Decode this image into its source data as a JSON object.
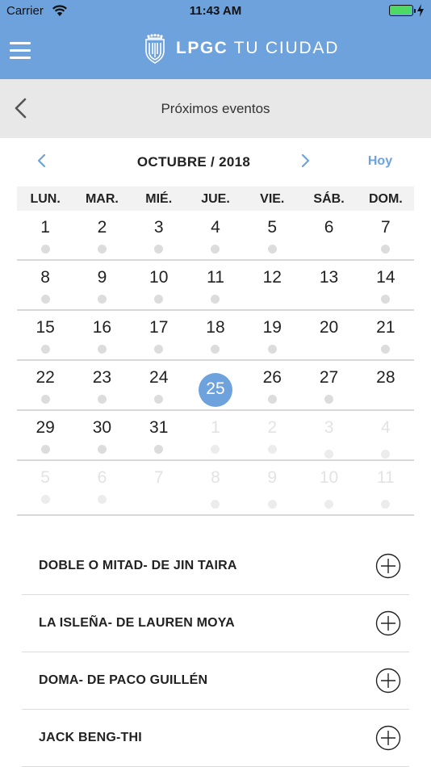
{
  "status": {
    "carrier": "Carrier",
    "time": "11:43 AM"
  },
  "header": {
    "brand_bold": "LPGC",
    "brand_light": "TU CIUDAD"
  },
  "subheader": {
    "title": "Próximos eventos"
  },
  "calendar": {
    "month_label": "OCTUBRE / 2018",
    "today_label": "Hoy",
    "weekdays": [
      "LUN.",
      "MAR.",
      "MIÉ.",
      "JUE.",
      "VIE.",
      "SÁB.",
      "DOM."
    ],
    "weeks": [
      [
        {
          "d": "1",
          "dot": "up"
        },
        {
          "d": "2",
          "dot": "up"
        },
        {
          "d": "3",
          "dot": "up"
        },
        {
          "d": "4",
          "dot": "up"
        },
        {
          "d": "5",
          "dot": "up"
        },
        {
          "d": "6",
          "dot": ""
        },
        {
          "d": "7",
          "dot": "up"
        }
      ],
      [
        {
          "d": "8",
          "dot": "up"
        },
        {
          "d": "9",
          "dot": "up"
        },
        {
          "d": "10",
          "dot": "up"
        },
        {
          "d": "11",
          "dot": "up"
        },
        {
          "d": "12",
          "dot": ""
        },
        {
          "d": "13",
          "dot": ""
        },
        {
          "d": "14",
          "dot": "up"
        }
      ],
      [
        {
          "d": "15",
          "dot": "up"
        },
        {
          "d": "16",
          "dot": "up"
        },
        {
          "d": "17",
          "dot": "up"
        },
        {
          "d": "18",
          "dot": "up"
        },
        {
          "d": "19",
          "dot": "up"
        },
        {
          "d": "20",
          "dot": ""
        },
        {
          "d": "21",
          "dot": "up"
        }
      ],
      [
        {
          "d": "22",
          "dot": "up"
        },
        {
          "d": "23",
          "dot": "up"
        },
        {
          "d": "24",
          "dot": "up"
        },
        {
          "d": "25",
          "dot": "up",
          "selected": true
        },
        {
          "d": "26",
          "dot": "up"
        },
        {
          "d": "27",
          "dot": "up"
        },
        {
          "d": "28",
          "dot": ""
        }
      ],
      [
        {
          "d": "29",
          "dot": "up"
        },
        {
          "d": "30",
          "dot": "up"
        },
        {
          "d": "31",
          "dot": "up"
        },
        {
          "d": "1",
          "dot": "up",
          "other": true
        },
        {
          "d": "2",
          "dot": "up",
          "other": true
        },
        {
          "d": "3",
          "dot": "down",
          "other": true
        },
        {
          "d": "4",
          "dot": "down",
          "other": true
        }
      ],
      [
        {
          "d": "5",
          "dot": "up",
          "other": true
        },
        {
          "d": "6",
          "dot": "up",
          "other": true
        },
        {
          "d": "7",
          "dot": "",
          "other": true
        },
        {
          "d": "8",
          "dot": "down",
          "other": true
        },
        {
          "d": "9",
          "dot": "down",
          "other": true
        },
        {
          "d": "10",
          "dot": "down",
          "other": true
        },
        {
          "d": "11",
          "dot": "down",
          "other": true
        }
      ]
    ]
  },
  "events": [
    {
      "title": "DOBLE O MITAD- DE JIN TAIRA"
    },
    {
      "title": "LA ISLEÑA- DE LAUREN MOYA"
    },
    {
      "title": "DOMA- DE PACO GUILLÉN"
    },
    {
      "title": "JACK BENG-THI"
    }
  ],
  "icons": {
    "menu": "hamburger-menu-icon",
    "back": "chevron-left-icon",
    "prev": "chevron-left-icon",
    "next": "chevron-right-icon",
    "add": "plus-circle-icon",
    "brand": "crest-icon"
  },
  "colors": {
    "accent": "#6ea2dc",
    "subheader_bg": "#e8e8e8",
    "dot": "#dcdcdc"
  }
}
